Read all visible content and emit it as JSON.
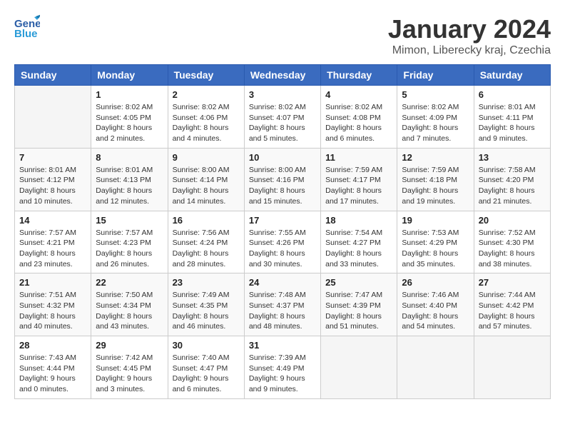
{
  "logo": {
    "part1": "General",
    "part2": "Blue"
  },
  "title": "January 2024",
  "subtitle": "Mimon, Liberecky kraj, Czechia",
  "weekdays": [
    "Sunday",
    "Monday",
    "Tuesday",
    "Wednesday",
    "Thursday",
    "Friday",
    "Saturday"
  ],
  "weeks": [
    [
      {
        "day": "",
        "info": ""
      },
      {
        "day": "1",
        "info": "Sunrise: 8:02 AM\nSunset: 4:05 PM\nDaylight: 8 hours\nand 2 minutes."
      },
      {
        "day": "2",
        "info": "Sunrise: 8:02 AM\nSunset: 4:06 PM\nDaylight: 8 hours\nand 4 minutes."
      },
      {
        "day": "3",
        "info": "Sunrise: 8:02 AM\nSunset: 4:07 PM\nDaylight: 8 hours\nand 5 minutes."
      },
      {
        "day": "4",
        "info": "Sunrise: 8:02 AM\nSunset: 4:08 PM\nDaylight: 8 hours\nand 6 minutes."
      },
      {
        "day": "5",
        "info": "Sunrise: 8:02 AM\nSunset: 4:09 PM\nDaylight: 8 hours\nand 7 minutes."
      },
      {
        "day": "6",
        "info": "Sunrise: 8:01 AM\nSunset: 4:11 PM\nDaylight: 8 hours\nand 9 minutes."
      }
    ],
    [
      {
        "day": "7",
        "info": "Sunrise: 8:01 AM\nSunset: 4:12 PM\nDaylight: 8 hours\nand 10 minutes."
      },
      {
        "day": "8",
        "info": "Sunrise: 8:01 AM\nSunset: 4:13 PM\nDaylight: 8 hours\nand 12 minutes."
      },
      {
        "day": "9",
        "info": "Sunrise: 8:00 AM\nSunset: 4:14 PM\nDaylight: 8 hours\nand 14 minutes."
      },
      {
        "day": "10",
        "info": "Sunrise: 8:00 AM\nSunset: 4:16 PM\nDaylight: 8 hours\nand 15 minutes."
      },
      {
        "day": "11",
        "info": "Sunrise: 7:59 AM\nSunset: 4:17 PM\nDaylight: 8 hours\nand 17 minutes."
      },
      {
        "day": "12",
        "info": "Sunrise: 7:59 AM\nSunset: 4:18 PM\nDaylight: 8 hours\nand 19 minutes."
      },
      {
        "day": "13",
        "info": "Sunrise: 7:58 AM\nSunset: 4:20 PM\nDaylight: 8 hours\nand 21 minutes."
      }
    ],
    [
      {
        "day": "14",
        "info": "Sunrise: 7:57 AM\nSunset: 4:21 PM\nDaylight: 8 hours\nand 23 minutes."
      },
      {
        "day": "15",
        "info": "Sunrise: 7:57 AM\nSunset: 4:23 PM\nDaylight: 8 hours\nand 26 minutes."
      },
      {
        "day": "16",
        "info": "Sunrise: 7:56 AM\nSunset: 4:24 PM\nDaylight: 8 hours\nand 28 minutes."
      },
      {
        "day": "17",
        "info": "Sunrise: 7:55 AM\nSunset: 4:26 PM\nDaylight: 8 hours\nand 30 minutes."
      },
      {
        "day": "18",
        "info": "Sunrise: 7:54 AM\nSunset: 4:27 PM\nDaylight: 8 hours\nand 33 minutes."
      },
      {
        "day": "19",
        "info": "Sunrise: 7:53 AM\nSunset: 4:29 PM\nDaylight: 8 hours\nand 35 minutes."
      },
      {
        "day": "20",
        "info": "Sunrise: 7:52 AM\nSunset: 4:30 PM\nDaylight: 8 hours\nand 38 minutes."
      }
    ],
    [
      {
        "day": "21",
        "info": "Sunrise: 7:51 AM\nSunset: 4:32 PM\nDaylight: 8 hours\nand 40 minutes."
      },
      {
        "day": "22",
        "info": "Sunrise: 7:50 AM\nSunset: 4:34 PM\nDaylight: 8 hours\nand 43 minutes."
      },
      {
        "day": "23",
        "info": "Sunrise: 7:49 AM\nSunset: 4:35 PM\nDaylight: 8 hours\nand 46 minutes."
      },
      {
        "day": "24",
        "info": "Sunrise: 7:48 AM\nSunset: 4:37 PM\nDaylight: 8 hours\nand 48 minutes."
      },
      {
        "day": "25",
        "info": "Sunrise: 7:47 AM\nSunset: 4:39 PM\nDaylight: 8 hours\nand 51 minutes."
      },
      {
        "day": "26",
        "info": "Sunrise: 7:46 AM\nSunset: 4:40 PM\nDaylight: 8 hours\nand 54 minutes."
      },
      {
        "day": "27",
        "info": "Sunrise: 7:44 AM\nSunset: 4:42 PM\nDaylight: 8 hours\nand 57 minutes."
      }
    ],
    [
      {
        "day": "28",
        "info": "Sunrise: 7:43 AM\nSunset: 4:44 PM\nDaylight: 9 hours\nand 0 minutes."
      },
      {
        "day": "29",
        "info": "Sunrise: 7:42 AM\nSunset: 4:45 PM\nDaylight: 9 hours\nand 3 minutes."
      },
      {
        "day": "30",
        "info": "Sunrise: 7:40 AM\nSunset: 4:47 PM\nDaylight: 9 hours\nand 6 minutes."
      },
      {
        "day": "31",
        "info": "Sunrise: 7:39 AM\nSunset: 4:49 PM\nDaylight: 9 hours\nand 9 minutes."
      },
      {
        "day": "",
        "info": ""
      },
      {
        "day": "",
        "info": ""
      },
      {
        "day": "",
        "info": ""
      }
    ]
  ]
}
